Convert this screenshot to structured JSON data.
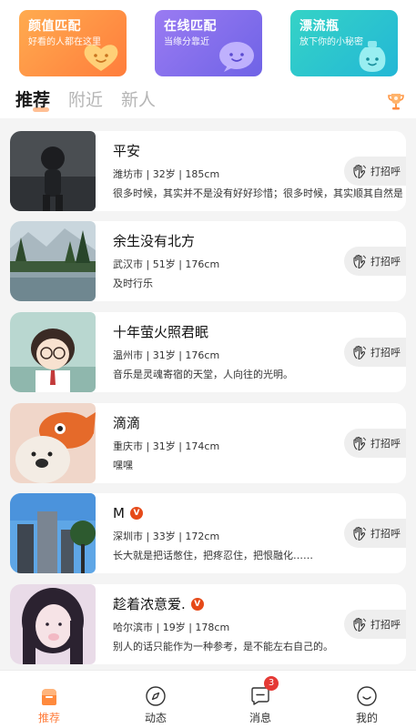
{
  "cards": [
    {
      "title": "颜值匹配",
      "subtitle": "好看的人都在这里",
      "color": "#ff8c42"
    },
    {
      "title": "在线匹配",
      "subtitle": "当缘分靠近",
      "color": "#7f6cf0"
    },
    {
      "title": "漂流瓶",
      "subtitle": "放下你的小秘密",
      "color": "#2cc6cf"
    }
  ],
  "tabs": [
    {
      "label": "推荐",
      "active": true
    },
    {
      "label": "附近",
      "active": false
    },
    {
      "label": "新人",
      "active": false
    }
  ],
  "rank_icon": "trophy-icon",
  "greet_label": "打招呼",
  "users": [
    {
      "name": "平安",
      "meta": "潍坊市 | 32岁 | 185cm",
      "bio": "很多时候，其实并不是没有好好珍惜；很多时候，其实顺其自然是…",
      "verified": false
    },
    {
      "name": "余生没有北方",
      "meta": "武汉市 | 51岁 | 176cm",
      "bio": "及时行乐",
      "verified": false
    },
    {
      "name": "十年萤火照君眠",
      "meta": "温州市 | 31岁 | 176cm",
      "bio": "音乐是灵魂寄宿的天堂，人向往的光明。",
      "verified": false
    },
    {
      "name": "滴滴",
      "meta": "重庆市 | 31岁 | 174cm",
      "bio": "嘿嘿",
      "verified": false
    },
    {
      "name": "M",
      "meta": "深圳市 | 33岁 | 172cm",
      "bio": "长大就是把话憋住，把疼忍住，把恨融化……",
      "verified": true,
      "badge": "V"
    },
    {
      "name": "趁着浓意爱.",
      "meta": "哈尔滨市 | 19岁 | 178cm",
      "bio": "别人的话只能作为一种参考，是不能左右自己的。",
      "verified": true,
      "badge": "V"
    }
  ],
  "nav": [
    {
      "label": "推荐",
      "icon": "home-icon",
      "active": true
    },
    {
      "label": "动态",
      "icon": "compass-icon",
      "active": false
    },
    {
      "label": "消息",
      "icon": "message-icon",
      "active": false,
      "badge": "3"
    },
    {
      "label": "我的",
      "icon": "smile-icon",
      "active": false
    }
  ],
  "colors": {
    "accent": "#ff7b3a",
    "badge_red": "#e53935",
    "verified_red": "#e64a19"
  }
}
